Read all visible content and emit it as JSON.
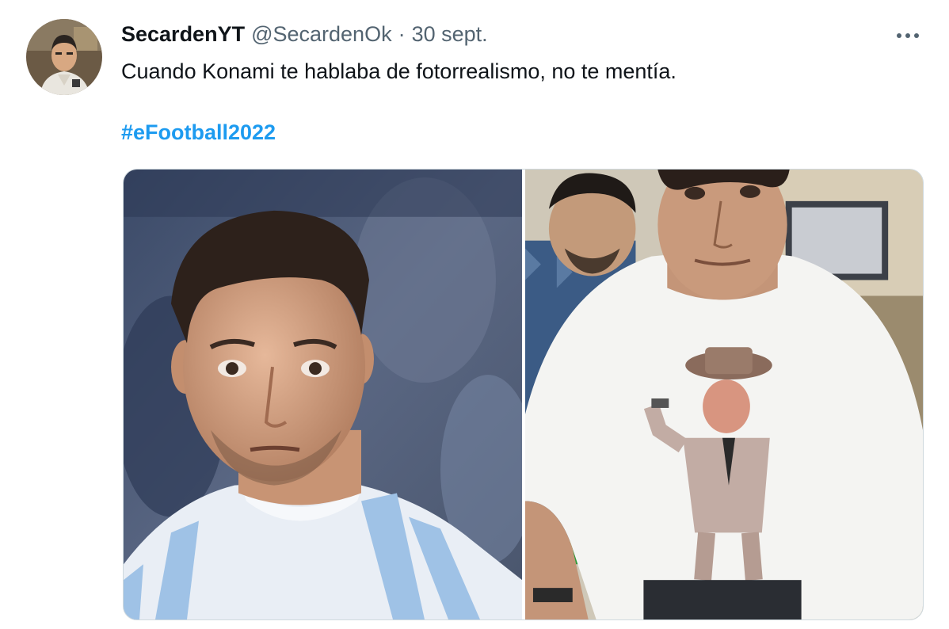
{
  "tweet": {
    "display_name": "SecardenYT",
    "handle": "@SecardenOk",
    "separator": "·",
    "timestamp": "30 sept.",
    "text": "Cuando Konami te hablaba de fotorrealismo, no te mentía.",
    "hashtag": "#eFootball2022",
    "more_icon": "more-horizontal-icon",
    "colors": {
      "text": "#0f1419",
      "secondary": "#536471",
      "link": "#1d9bf0",
      "border": "#cfd9de"
    }
  },
  "media": {
    "photos": [
      {
        "alt": "",
        "kind": "render-of-footballer"
      },
      {
        "alt": "",
        "kind": "photo-of-man-in-printed-tshirt"
      }
    ]
  }
}
